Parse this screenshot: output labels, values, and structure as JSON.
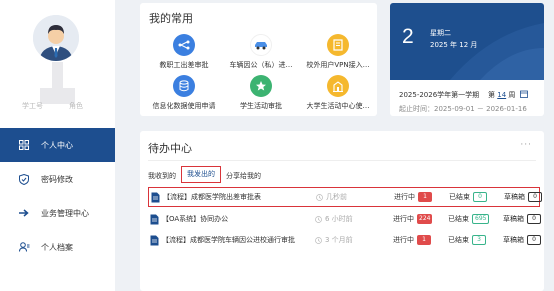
{
  "user": {
    "id_label": "学工号",
    "role_label": "角色"
  },
  "nav": [
    {
      "label": "个人中心",
      "icon": "grid-icon",
      "active": true
    },
    {
      "label": "密码修改",
      "icon": "shield-icon"
    },
    {
      "label": "业务管理中心",
      "icon": "arrow-right-icon"
    },
    {
      "label": "个人档案",
      "icon": "user-profile-icon"
    }
  ],
  "favorites": {
    "title": "我的常用",
    "items": [
      {
        "label": "教职工出差审批",
        "icon": "workflow-icon",
        "color": "#3b7fe0"
      },
      {
        "label": "车辆因公（私）进…",
        "icon": "car-icon",
        "color": "#ffffff"
      },
      {
        "label": "校外用户VPN接入…",
        "icon": "vpn-icon",
        "color": "#f5b82e"
      },
      {
        "label": "信息化数据使用申请",
        "icon": "data-icon",
        "color": "#3b7fe0"
      },
      {
        "label": "学生活动审批",
        "icon": "activity-icon",
        "color": "#3cb371"
      },
      {
        "label": "大学生活动中心使…",
        "icon": "building-icon",
        "color": "#f5b82e"
      }
    ]
  },
  "date": {
    "day": "2",
    "weekday": "星期二",
    "yearmonth": "2025 年 12 月",
    "term": "2025-2026学年第一学期",
    "week_prefix": "第",
    "week_num": "14",
    "week_suffix": "周",
    "range": "起止时间：2025-09-01 － 2026-01-16"
  },
  "todo": {
    "title": "待办中心",
    "more": "···",
    "tabs": [
      "我收到的",
      "我发出的",
      "分享给我的"
    ],
    "status_labels": {
      "in_progress": "进行中",
      "done": "已结束",
      "draft": "草稿箱"
    },
    "rows": [
      {
        "title": "【流程】成都医学院出差审批表",
        "time": "几秒前",
        "in_progress": "1",
        "done": "0",
        "draft": "0"
      },
      {
        "title": "【OA系统】协同办公",
        "time": "6 小时前",
        "in_progress": "224",
        "done": "695",
        "draft": "0"
      },
      {
        "title": "【流程】成都医学院车辆因公进校通行审批",
        "time": "3 个月前",
        "in_progress": "1",
        "done": "3",
        "draft": "0"
      }
    ]
  },
  "colors": {
    "primary": "#1d4e8f",
    "highlight": "#d9343a",
    "badge_red": "#e04b4b",
    "badge_green": "#38b48b"
  }
}
